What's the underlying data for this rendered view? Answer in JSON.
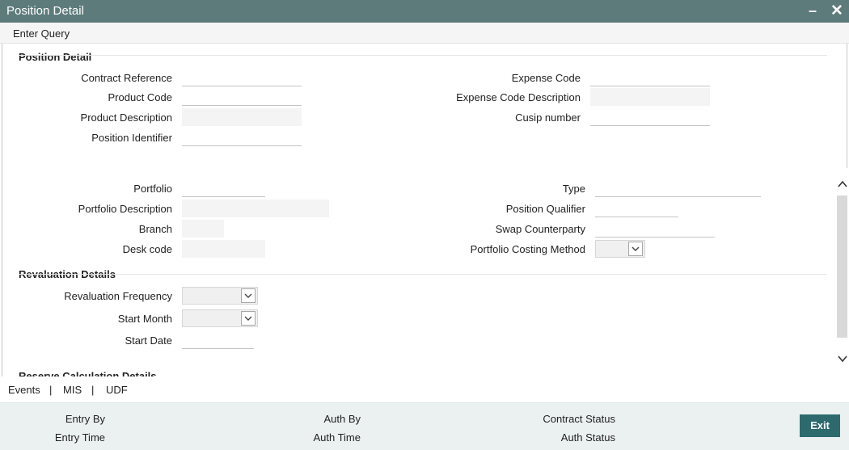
{
  "window": {
    "title": "Position Detail",
    "minimize": "–",
    "close": "✕"
  },
  "menu": {
    "enter_query": "Enter Query"
  },
  "position_detail": {
    "title": "Position Detail",
    "contract_reference": {
      "label": "Contract Reference",
      "value": ""
    },
    "product_code": {
      "label": "Product Code",
      "value": ""
    },
    "product_description": {
      "label": "Product Description",
      "value": ""
    },
    "position_identifier": {
      "label": "Position Identifier",
      "value": ""
    },
    "expense_code": {
      "label": "Expense Code",
      "value": ""
    },
    "expense_code_description": {
      "label": "Expense Code Description",
      "value": ""
    },
    "cusip_number": {
      "label": "Cusip number",
      "value": ""
    },
    "portfolio": {
      "label": "Portfolio",
      "value": ""
    },
    "portfolio_description": {
      "label": "Portfolio Description",
      "value": ""
    },
    "branch": {
      "label": "Branch",
      "value": ""
    },
    "desk_code": {
      "label": "Desk code",
      "value": ""
    },
    "type": {
      "label": "Type",
      "value": ""
    },
    "position_qualifier": {
      "label": "Position Qualifier",
      "value": ""
    },
    "swap_counterparty": {
      "label": "Swap Counterparty",
      "value": ""
    },
    "portfolio_costing_method": {
      "label": "Portfolio Costing Method",
      "value": ""
    }
  },
  "revaluation": {
    "title": "Revaluation Details",
    "frequency": {
      "label": "Revaluation Frequency",
      "value": ""
    },
    "start_month": {
      "label": "Start Month",
      "value": ""
    },
    "start_date": {
      "label": "Start Date",
      "value": ""
    }
  },
  "reserve": {
    "title": "Reserve Calculation Details"
  },
  "links": {
    "events": "Events",
    "mis": "MIS",
    "udf": "UDF",
    "separator": "|"
  },
  "footer": {
    "entry_by": "Entry By",
    "entry_time": "Entry Time",
    "auth_by": "Auth By",
    "auth_time": "Auth Time",
    "contract_status": "Contract Status",
    "auth_status": "Auth Status",
    "exit": "Exit"
  },
  "colors": {
    "titlebar": "#5e7b7c",
    "exit_button": "#2c6a6e",
    "footer_bg": "#ebf0f0"
  },
  "icons": {
    "minimize": "minimize-icon",
    "close": "close-icon",
    "dropdown": "chevron-down-icon",
    "scroll_up": "chevron-up-icon",
    "scroll_down": "chevron-down-icon"
  }
}
